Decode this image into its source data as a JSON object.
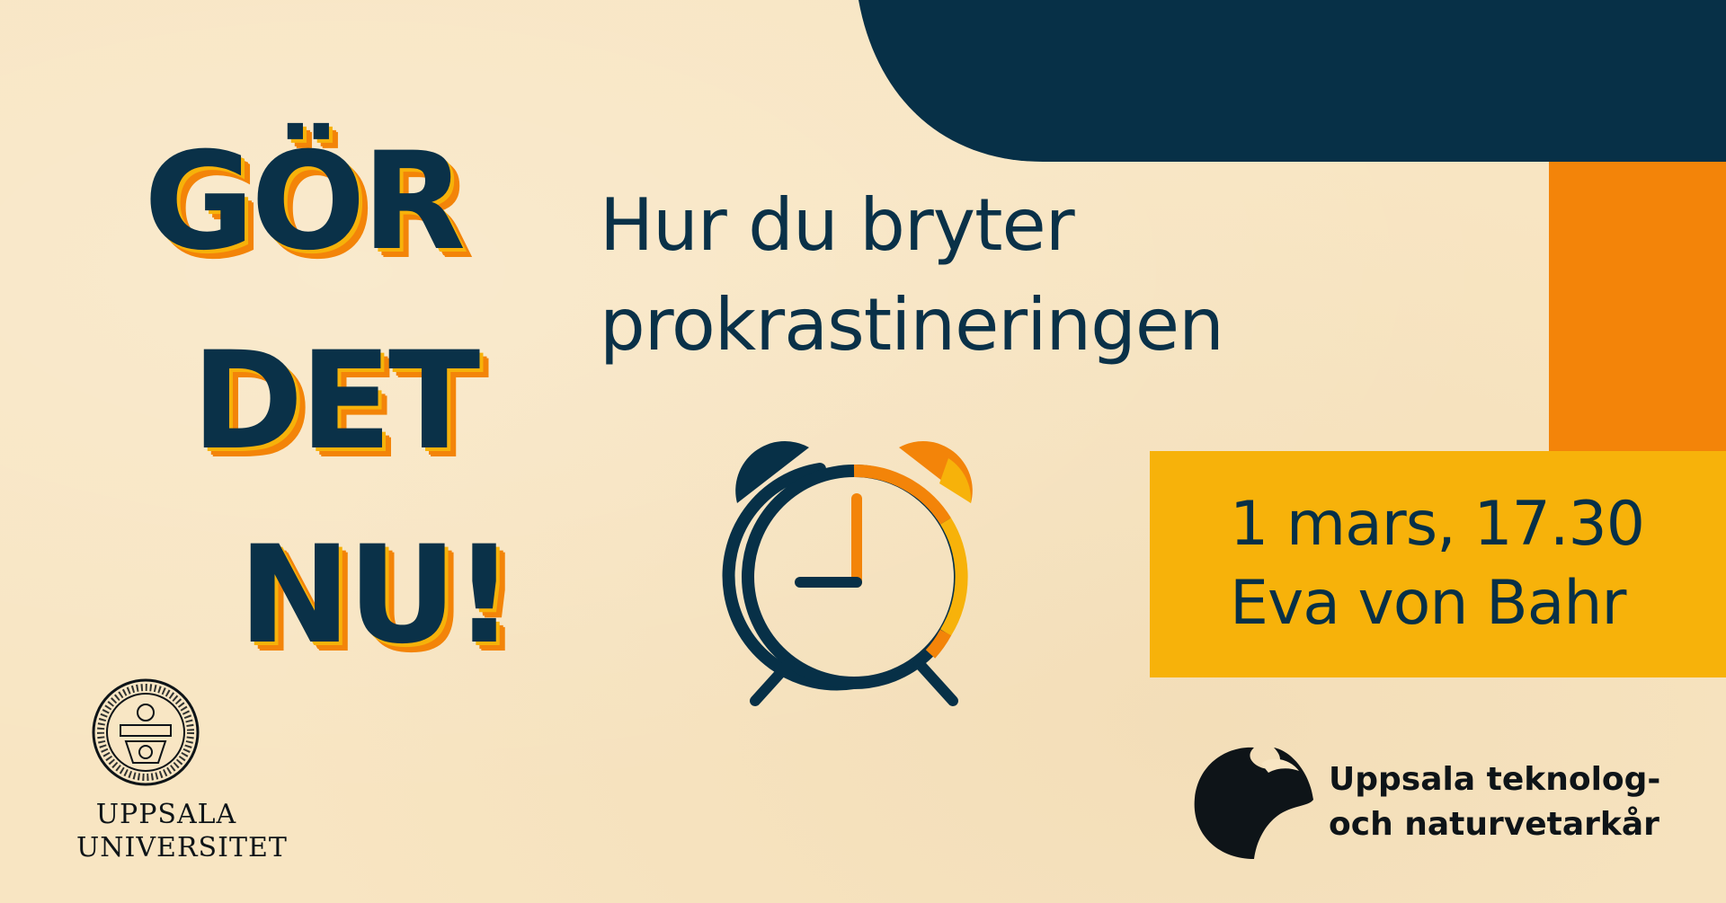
{
  "headline": {
    "line1": "GÖR",
    "line2": "DET",
    "line3": "NU!"
  },
  "subtitle": {
    "line1": "Hur du bryter",
    "line2": "prokrastineringen"
  },
  "event": {
    "date_time": "1 mars, 17.30",
    "speaker": "Eva von Bahr"
  },
  "logos": {
    "uppsala": {
      "line1": "UPPSALA",
      "line2": "UNIVERSITET"
    },
    "utn": {
      "line1": "Uppsala teknolog-",
      "line2": "och naturvetarkår"
    }
  },
  "colors": {
    "background": "#f8e5c2",
    "navy": "#073047",
    "orange": "#f38409",
    "yellow": "#f7b20a"
  },
  "icons": [
    "alarm-clock-icon",
    "uppsala-university-seal",
    "utn-logo-mark"
  ]
}
